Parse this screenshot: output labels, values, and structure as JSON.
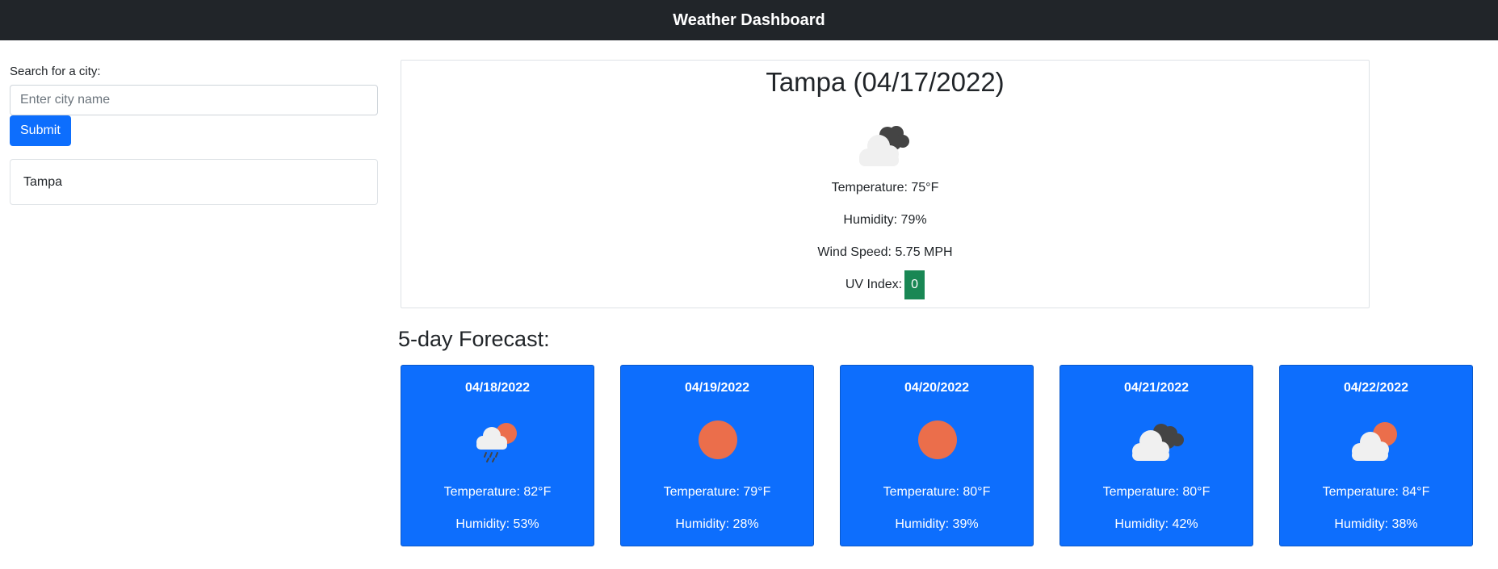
{
  "header": {
    "title": "Weather Dashboard"
  },
  "search": {
    "label": "Search for a city:",
    "placeholder": "Enter city name",
    "value": "",
    "submit_label": "Submit"
  },
  "history": {
    "items": [
      "Tampa"
    ]
  },
  "current": {
    "title": "Tampa (04/17/2022)",
    "icon": "cloudy-icon",
    "temperature": "Temperature: 75°F",
    "humidity": "Humidity: 79%",
    "wind": "Wind Speed: 5.75 MPH",
    "uv_label": "UV Index:",
    "uv_value": "0",
    "uv_color": "#198754"
  },
  "forecast": {
    "heading": "5-day Forecast:",
    "days": [
      {
        "date": "04/18/2022",
        "icon": "rain-sun-icon",
        "temperature": "Temperature: 82°F",
        "humidity": "Humidity: 53%"
      },
      {
        "date": "04/19/2022",
        "icon": "sun-icon",
        "temperature": "Temperature: 79°F",
        "humidity": "Humidity: 28%"
      },
      {
        "date": "04/20/2022",
        "icon": "sun-icon",
        "temperature": "Temperature: 80°F",
        "humidity": "Humidity: 39%"
      },
      {
        "date": "04/21/2022",
        "icon": "cloudy-icon",
        "temperature": "Temperature: 80°F",
        "humidity": "Humidity: 42%"
      },
      {
        "date": "04/22/2022",
        "icon": "partly-cloudy-icon",
        "temperature": "Temperature: 84°F",
        "humidity": "Humidity: 38%"
      }
    ]
  },
  "colors": {
    "accent": "#0d6efd",
    "navbar": "#212529",
    "sun": "#eb6e4b",
    "dark_cloud": "#444444",
    "light_cloud": "#f0f0f0"
  }
}
